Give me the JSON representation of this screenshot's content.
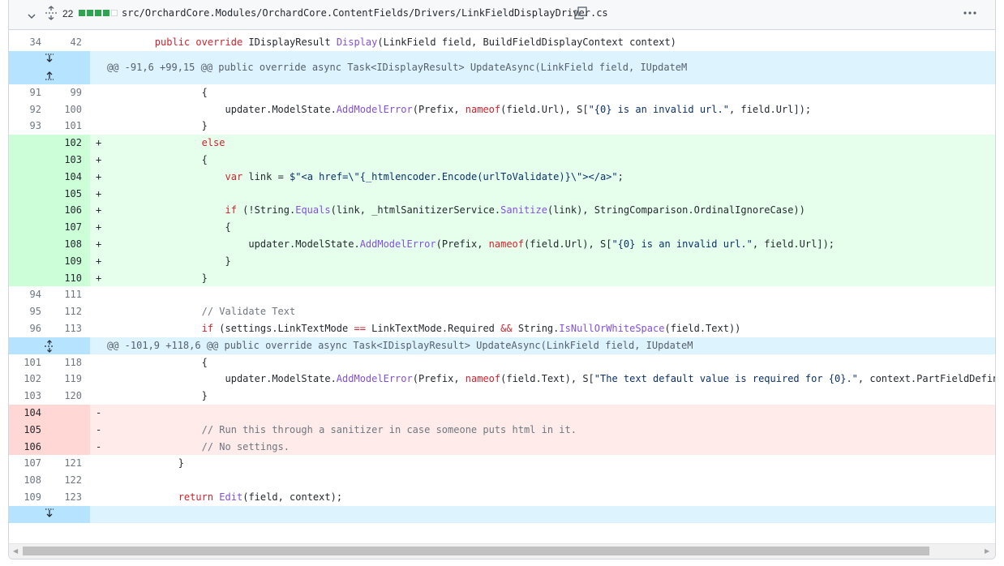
{
  "file": {
    "change_count": "22",
    "path": "src/OrchardCore.Modules/OrchardCore.ContentFields/Drivers/LinkFieldDisplayDriver.cs",
    "diffstat": [
      "added",
      "added",
      "added",
      "added",
      "neutral"
    ],
    "colors": {
      "added": "#2da44e",
      "neutral": "#d0d7de",
      "hunk_bg": "#ddf4ff",
      "hunk_gutter": "#b6e3ff",
      "add_bg": "#e6ffec",
      "del_bg": "#ffebe9"
    }
  },
  "icons": {
    "chevron": "chevron-down-icon",
    "expand": "unfold-icon",
    "copy": "copy-icon",
    "kebab": "kebab-horizontal-icon"
  },
  "lines": [
    {
      "type": "ctx",
      "old": "34",
      "new": "42",
      "sign": "",
      "code": "        public override IDisplayResult Display(LinkField field, BuildFieldDisplayContext context)"
    },
    {
      "type": "hunk",
      "code": "@@ -91,6 +99,15 @@ public override async Task<IDisplayResult> UpdateAsync(LinkField field, IUpdateM"
    },
    {
      "type": "ctx",
      "old": "91",
      "new": "99",
      "sign": "",
      "code": "                {"
    },
    {
      "type": "ctx",
      "old": "92",
      "new": "100",
      "sign": "",
      "code": "                    updater.ModelState.AddModelError(Prefix, nameof(field.Url), S[\"{0} is an invalid url.\", field.Url]);"
    },
    {
      "type": "ctx",
      "old": "93",
      "new": "101",
      "sign": "",
      "code": "                }"
    },
    {
      "type": "add",
      "old": "",
      "new": "102",
      "sign": "+",
      "code": "                else"
    },
    {
      "type": "add",
      "old": "",
      "new": "103",
      "sign": "+",
      "code": "                {"
    },
    {
      "type": "add",
      "old": "",
      "new": "104",
      "sign": "+",
      "code": "                    var link = $\"<a href=\\\"{_htmlencoder.Encode(urlToValidate)}\\\"></a>\";"
    },
    {
      "type": "add",
      "old": "",
      "new": "105",
      "sign": "+",
      "code": ""
    },
    {
      "type": "add",
      "old": "",
      "new": "106",
      "sign": "+",
      "code": "                    if (!String.Equals(link, _htmlSanitizerService.Sanitize(link), StringComparison.OrdinalIgnoreCase))"
    },
    {
      "type": "add",
      "old": "",
      "new": "107",
      "sign": "+",
      "code": "                    {"
    },
    {
      "type": "add",
      "old": "",
      "new": "108",
      "sign": "+",
      "code": "                        updater.ModelState.AddModelError(Prefix, nameof(field.Url), S[\"{0} is an invalid url.\", field.Url]);"
    },
    {
      "type": "add",
      "old": "",
      "new": "109",
      "sign": "+",
      "code": "                    }"
    },
    {
      "type": "add",
      "old": "",
      "new": "110",
      "sign": "+",
      "code": "                }"
    },
    {
      "type": "ctx",
      "old": "94",
      "new": "111",
      "sign": "",
      "code": ""
    },
    {
      "type": "ctx",
      "old": "95",
      "new": "112",
      "sign": "",
      "code": "                // Validate Text"
    },
    {
      "type": "ctx",
      "old": "96",
      "new": "113",
      "sign": "",
      "code": "                if (settings.LinkTextMode == LinkTextMode.Required && String.IsNullOrWhiteSpace(field.Text))"
    },
    {
      "type": "hunk",
      "code": "@@ -101,9 +118,6 @@ public override async Task<IDisplayResult> UpdateAsync(LinkField field, IUpdateM"
    },
    {
      "type": "ctx",
      "old": "101",
      "new": "118",
      "sign": "",
      "code": "                {"
    },
    {
      "type": "ctx",
      "old": "102",
      "new": "119",
      "sign": "",
      "code": "                    updater.ModelState.AddModelError(Prefix, nameof(field.Text), S[\"The text default value is required for {0}.\", context.PartFieldDefinition.DisplayN"
    },
    {
      "type": "ctx",
      "old": "103",
      "new": "120",
      "sign": "",
      "code": "                }"
    },
    {
      "type": "del",
      "old": "104",
      "new": "",
      "sign": "-",
      "code": ""
    },
    {
      "type": "del",
      "old": "105",
      "new": "",
      "sign": "-",
      "code": "                // Run this through a sanitizer in case someone puts html in it."
    },
    {
      "type": "del",
      "old": "106",
      "new": "",
      "sign": "-",
      "code": "                // No settings."
    },
    {
      "type": "ctx",
      "old": "107",
      "new": "121",
      "sign": "",
      "code": "            }"
    },
    {
      "type": "ctx",
      "old": "108",
      "new": "122",
      "sign": "",
      "code": ""
    },
    {
      "type": "ctx",
      "old": "109",
      "new": "123",
      "sign": "",
      "code": "            return Edit(field, context);"
    },
    {
      "type": "hunk",
      "code": ""
    }
  ]
}
